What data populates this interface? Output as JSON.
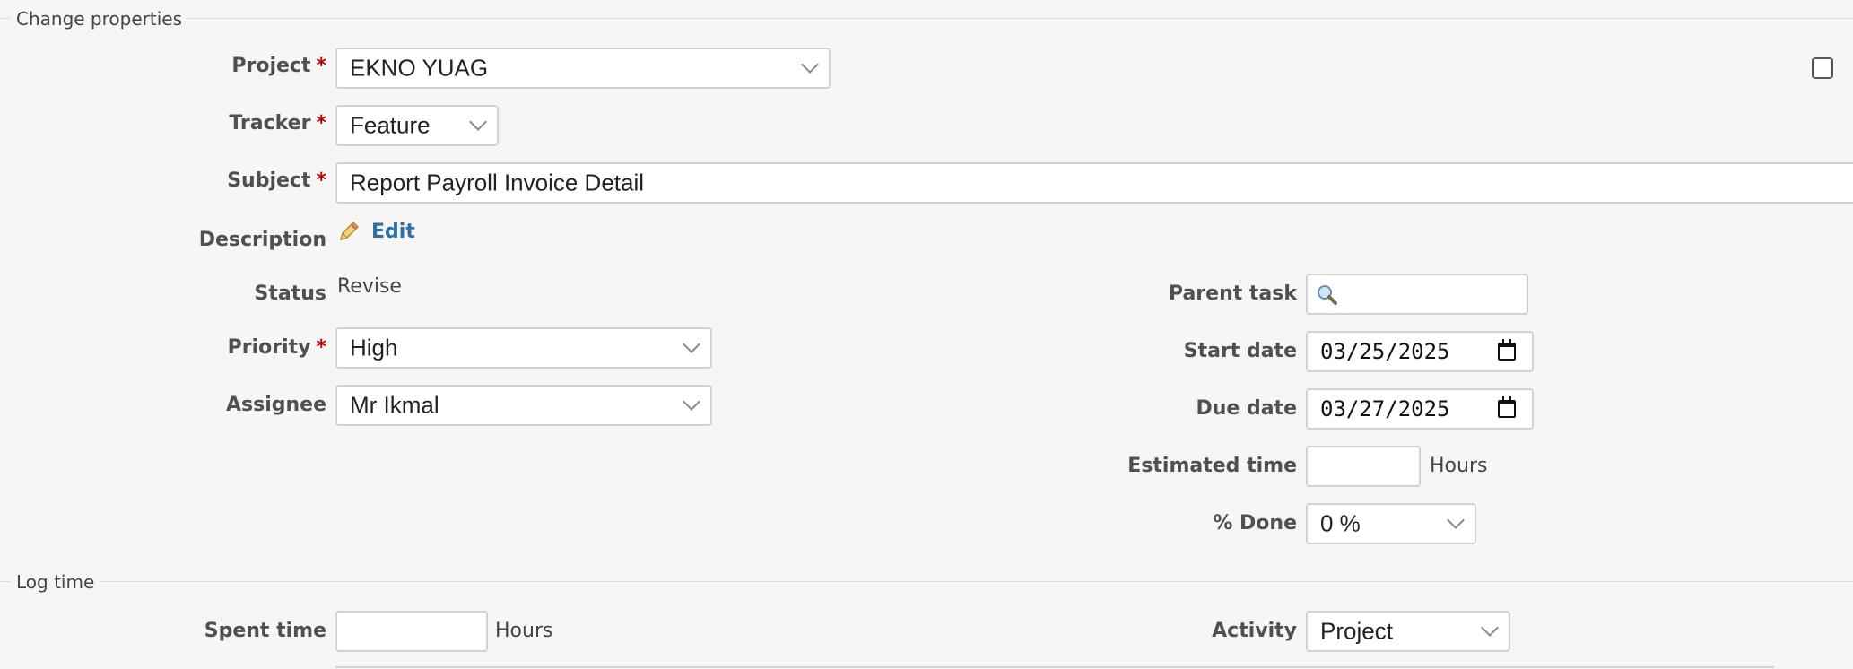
{
  "sections": {
    "change_properties": "Change properties",
    "log_time": "Log time"
  },
  "fields": {
    "project": {
      "label": "Project",
      "required": "*",
      "value": "EKNO YUAG"
    },
    "tracker": {
      "label": "Tracker",
      "required": "*",
      "value": "Feature"
    },
    "subject": {
      "label": "Subject",
      "required": "*",
      "value": "Report Payroll Invoice Detail"
    },
    "description": {
      "label": "Description",
      "edit_label": "Edit"
    },
    "status": {
      "label": "Status",
      "value": "Revise"
    },
    "priority": {
      "label": "Priority",
      "required": "*",
      "value": "High"
    },
    "assignee": {
      "label": "Assignee",
      "value": "Mr Ikmal"
    },
    "parent_task": {
      "label": "Parent task",
      "value": ""
    },
    "start_date": {
      "label": "Start date",
      "value": "03/25/2025"
    },
    "due_date": {
      "label": "Due date",
      "value": "03/27/2025"
    },
    "estimated_time": {
      "label": "Estimated time",
      "value": "",
      "unit": "Hours"
    },
    "done_ratio": {
      "label": "% Done",
      "value": "0 %"
    }
  },
  "log_time": {
    "spent_time": {
      "label": "Spent time",
      "value": "",
      "unit": "Hours"
    },
    "activity": {
      "label": "Activity",
      "value": "Project"
    }
  },
  "icons": {
    "pencil": "pencil-icon",
    "search": "search-icon",
    "calendar": "calendar-icon",
    "chevron": "chevron-down-icon"
  },
  "colors": {
    "required": "#bb0000",
    "link": "#2e6fa8",
    "background": "#f6f6f6"
  }
}
